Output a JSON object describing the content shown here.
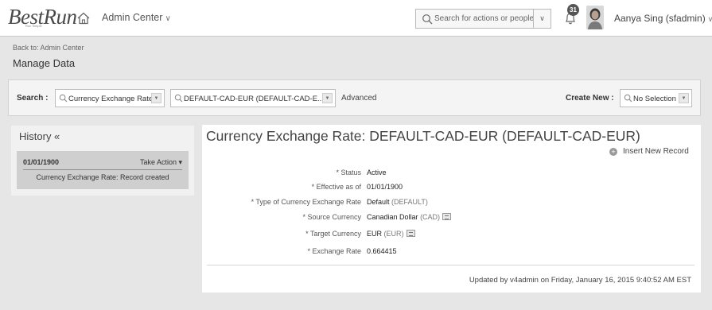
{
  "header": {
    "logo": "BestRun",
    "logo_tagline": "Run Simple",
    "module": "Admin Center",
    "search_placeholder": "Search for actions or people",
    "notification_count": "31",
    "user_name": "Aanya Sing (sfadmin)",
    "icons": [
      "home-icon",
      "search-icon",
      "bell-icon",
      "avatar"
    ]
  },
  "breadcrumb": {
    "back_link": "Back to: Admin Center"
  },
  "page": {
    "title": "Manage Data"
  },
  "search": {
    "label": "Search :",
    "type_value": "Currency Exchange Rate",
    "record_value": "DEFAULT-CAD-EUR (DEFAULT-CAD-E...",
    "advanced": "Advanced",
    "create_label": "Create New :",
    "create_value": "No Selection"
  },
  "history": {
    "title": "History «",
    "items": [
      {
        "date": "01/01/1900",
        "action": "Take Action ▾",
        "description": "Currency Exchange Rate: Record created"
      }
    ]
  },
  "record": {
    "title": "Currency Exchange Rate: DEFAULT-CAD-EUR (DEFAULT-CAD-EUR)",
    "insert_new": "Insert New Record",
    "fields": [
      {
        "label": "* Status",
        "value": "Active",
        "code": ""
      },
      {
        "label": "* Effective as of",
        "value": "01/01/1900",
        "code": ""
      },
      {
        "label": "* Type of Currency Exchange Rate",
        "value": "Default",
        "code": "(DEFAULT)"
      },
      {
        "label": "* Source Currency",
        "value": "Canadian Dollar",
        "code": "(CAD)"
      },
      {
        "label": "* Target Currency",
        "value": "EUR",
        "code": "(EUR)"
      },
      {
        "label": "* Exchange Rate",
        "value": "0.664415",
        "code": ""
      }
    ],
    "updated": "Updated by v4admin on Friday, January 16, 2015 9:40:52 AM EST"
  },
  "colors": {
    "page_background": "#e6e6e6",
    "panel_background": "#ffffff",
    "history_card": "#cfcfcf",
    "text": "#333333"
  }
}
